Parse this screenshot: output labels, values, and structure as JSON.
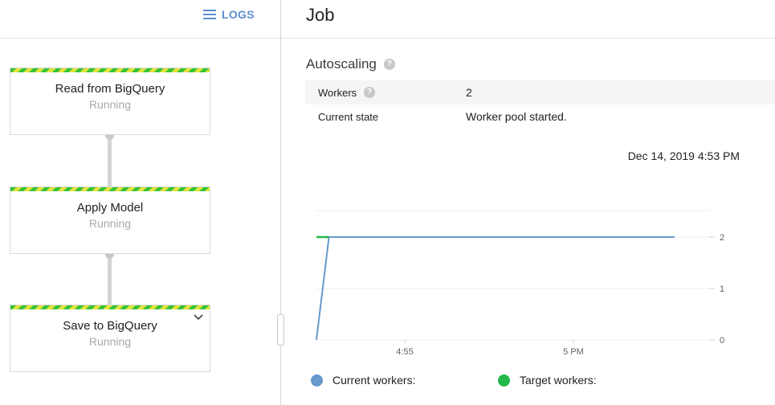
{
  "left": {
    "logs_label": "LOGS",
    "logs_icon": "list-icon",
    "steps": [
      {
        "name": "Read from BigQuery",
        "status": "Running"
      },
      {
        "name": "Apply Model",
        "status": "Running"
      },
      {
        "name": "Save to BigQuery",
        "status": "Running",
        "expand_icon": "chevron-down-icon"
      }
    ]
  },
  "right": {
    "title": "Job",
    "autoscaling": {
      "title": "Autoscaling",
      "help_icon": "help-icon",
      "help_glyph": "?",
      "rows": [
        {
          "key": "Workers",
          "value": "2"
        },
        {
          "key": "Current state",
          "value": "Worker pool started."
        }
      ]
    },
    "timestamp": "Dec 14, 2019 4:53 PM"
  },
  "chart_data": {
    "type": "line",
    "title": "",
    "xlabel": "",
    "ylabel": "",
    "x_ticks": [
      "4:55",
      "5 PM"
    ],
    "y_ticks": [
      "2",
      "1",
      "0"
    ],
    "ylim": [
      0,
      2
    ],
    "grid": true,
    "legend_position": "bottom",
    "series": [
      {
        "name": "Current workers:",
        "color": "#6699cc",
        "points": [
          [
            0,
            0
          ],
          [
            0.35,
            2
          ],
          [
            10,
            2
          ]
        ]
      },
      {
        "name": "Target workers:",
        "color": "#22b84a",
        "points": [
          [
            0,
            2
          ],
          [
            0.35,
            2
          ]
        ]
      }
    ]
  },
  "colors": {
    "accent": "#5b8ecf",
    "stripe_green": "#37c33a",
    "stripe_yellow": "#e3e33a"
  }
}
